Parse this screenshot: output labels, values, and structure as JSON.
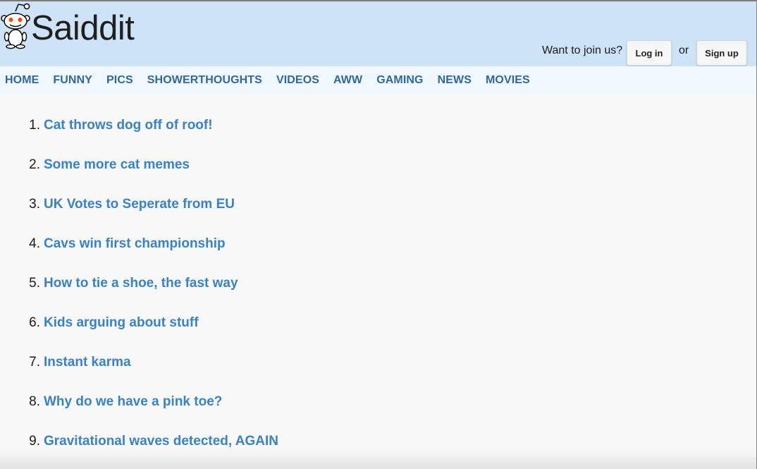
{
  "header": {
    "site_title": "Saiddit",
    "join_text": "Want to join us?",
    "login_label": "Log in",
    "or_text": "or",
    "signup_label": "Sign up",
    "logo_icon": "alien-mascot-icon"
  },
  "nav": {
    "items": [
      "HOME",
      "FUNNY",
      "PICS",
      "SHOWERTHOUGHTS",
      "VIDEOS",
      "AWW",
      "GAMING",
      "NEWS",
      "MOVIES"
    ]
  },
  "posts": [
    {
      "num": "1.",
      "title": "Cat throws dog off of roof!"
    },
    {
      "num": "2.",
      "title": "Some more cat memes"
    },
    {
      "num": "3.",
      "title": "UK Votes to Seperate from EU"
    },
    {
      "num": "4.",
      "title": "Cavs win first championship"
    },
    {
      "num": "5.",
      "title": "How to tie a shoe, the fast way"
    },
    {
      "num": "6.",
      "title": "Kids arguing about stuff"
    },
    {
      "num": "7.",
      "title": "Instant karma"
    },
    {
      "num": "8.",
      "title": "Why do we have a pink toe?"
    },
    {
      "num": "9.",
      "title": "Gravitational waves detected, AGAIN"
    }
  ],
  "colors": {
    "header_bg": "#cee3f8",
    "nav_bg": "#eff7ff",
    "nav_text": "#336699",
    "link": "#3a82c4",
    "logo_eyes": "#ff4500"
  }
}
